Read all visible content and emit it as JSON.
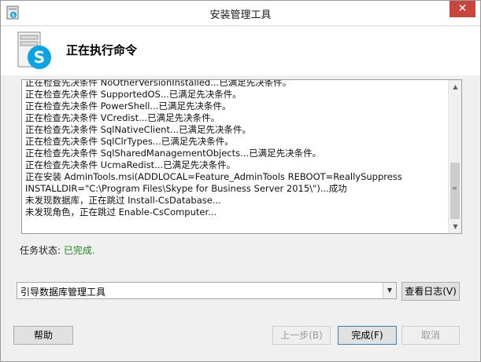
{
  "window": {
    "title": "安装管理工具",
    "close_glyph": "✕",
    "app_icon": "setup-app-icon"
  },
  "header": {
    "title": "正在执行命令",
    "icon": "skype-server-icon"
  },
  "log": {
    "lines": [
      "正在检查先决条件 NoOtherVersionInstalled...已满足先决条件。",
      "正在检查先决条件 SupportedOS...已满足先决条件。",
      "正在检查先决条件 PowerShell...已满足先决条件。",
      "正在检查先决条件 VCredist...已满足先决条件。",
      "正在检查先决条件 SqlNativeClient...已满足先决条件。",
      "正在检查先决条件 SqlClrTypes...已满足先决条件。",
      "正在检查先决条件 SqlSharedManagementObjects...已满足先决条件。",
      "正在检查先决条件 UcmaRedist...已满足先决条件。",
      "正在安装 AdminTools.msi(ADDLOCAL=Feature_AdminTools REBOOT=ReallySuppress",
      "INSTALLDIR=\"C:\\Program Files\\Skype for Business Server 2015\\\")...成功",
      "未发现数据库，正在跳过 Install-CsDatabase...",
      "未发现角色，正在跳过 Enable-CsComputer..."
    ]
  },
  "status": {
    "label": "任务状态: ",
    "value": "已完成."
  },
  "dropdown": {
    "selected": "引导数据库管理工具"
  },
  "buttons": {
    "view_log": "查看日志(V)",
    "help": "帮助",
    "back": "上一步(B)",
    "finish": "完成(F)",
    "cancel": "取消"
  },
  "colors": {
    "status_ok": "#1b8a1b",
    "close_red": "#c7453b",
    "skype_blue": "#0aa3e6"
  }
}
